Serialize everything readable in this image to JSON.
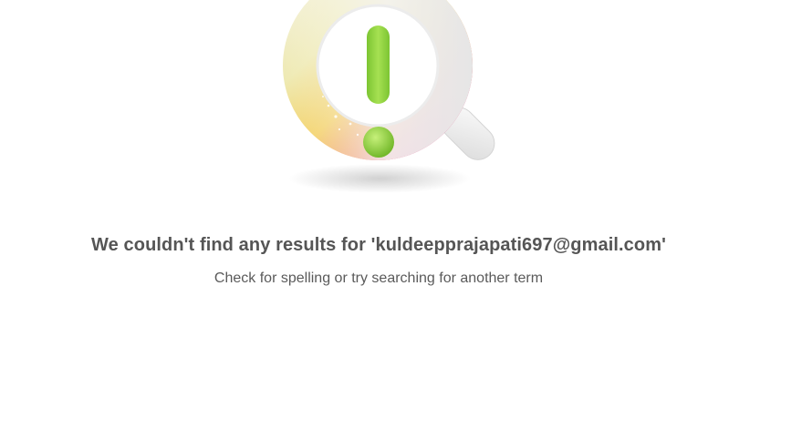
{
  "empty_state": {
    "illustration_icon": "no-results-magnifier-exclamation-icon",
    "heading": "We couldn't find any results for 'kuldeepprajapati697@gmail.com'",
    "subtext": "Check for spelling or try searching for another term"
  },
  "colors": {
    "background": "#ffffff",
    "heading_text": "#555555",
    "subtext": "#5a5a5a",
    "exclamation_green": "#8cd63a"
  }
}
